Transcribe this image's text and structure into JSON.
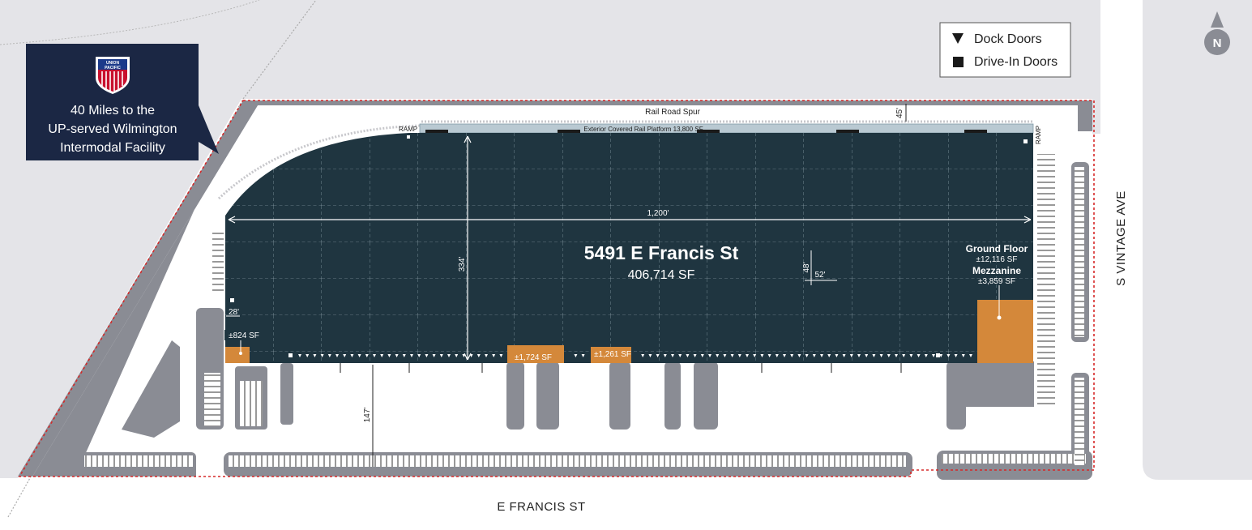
{
  "building": {
    "address": "5491 E Francis St",
    "area": "406,714 SF",
    "length_label": "1,200'",
    "depth_label": "334'",
    "bay_depth_label": "48'",
    "bay_width_label": "52'",
    "setback_left_label": "28'",
    "truck_court_label": "147'",
    "rail_clearance_label": "45'"
  },
  "rail": {
    "spur_label": "Rail Road Spur",
    "platform_label": "Exterior Covered Rail Platform 13,800 SF",
    "ramp_left": "RAMP",
    "ramp_right": "RAMP"
  },
  "offices": {
    "left_sf": "±824 SF",
    "mid1_sf": "±1,724 SF",
    "mid2_sf": "±1,261 SF",
    "main_ground_title": "Ground Floor",
    "main_ground_sf": "±12,116 SF",
    "main_mezz_title": "Mezzanine",
    "main_mezz_sf": "±3,859 SF"
  },
  "legend": {
    "dock_doors": "Dock Doors",
    "drive_in_doors": "Drive-In Doors"
  },
  "callout": {
    "logo_line1": "UNION",
    "logo_line2": "PACIFIC",
    "line1": "40 Miles to the",
    "line2": "UP-served Wilmington",
    "line3": "Intermodal Facility"
  },
  "streets": {
    "south": "E FRANCIS ST",
    "east": "S VINTAGE AVE"
  },
  "north_label": "N",
  "colors": {
    "building": "#1f3540",
    "office": "#d4883a",
    "road": "#e4e4e8",
    "pavement": "#8a8c94",
    "callout": "#1b2744",
    "property_line": "#d62828"
  }
}
